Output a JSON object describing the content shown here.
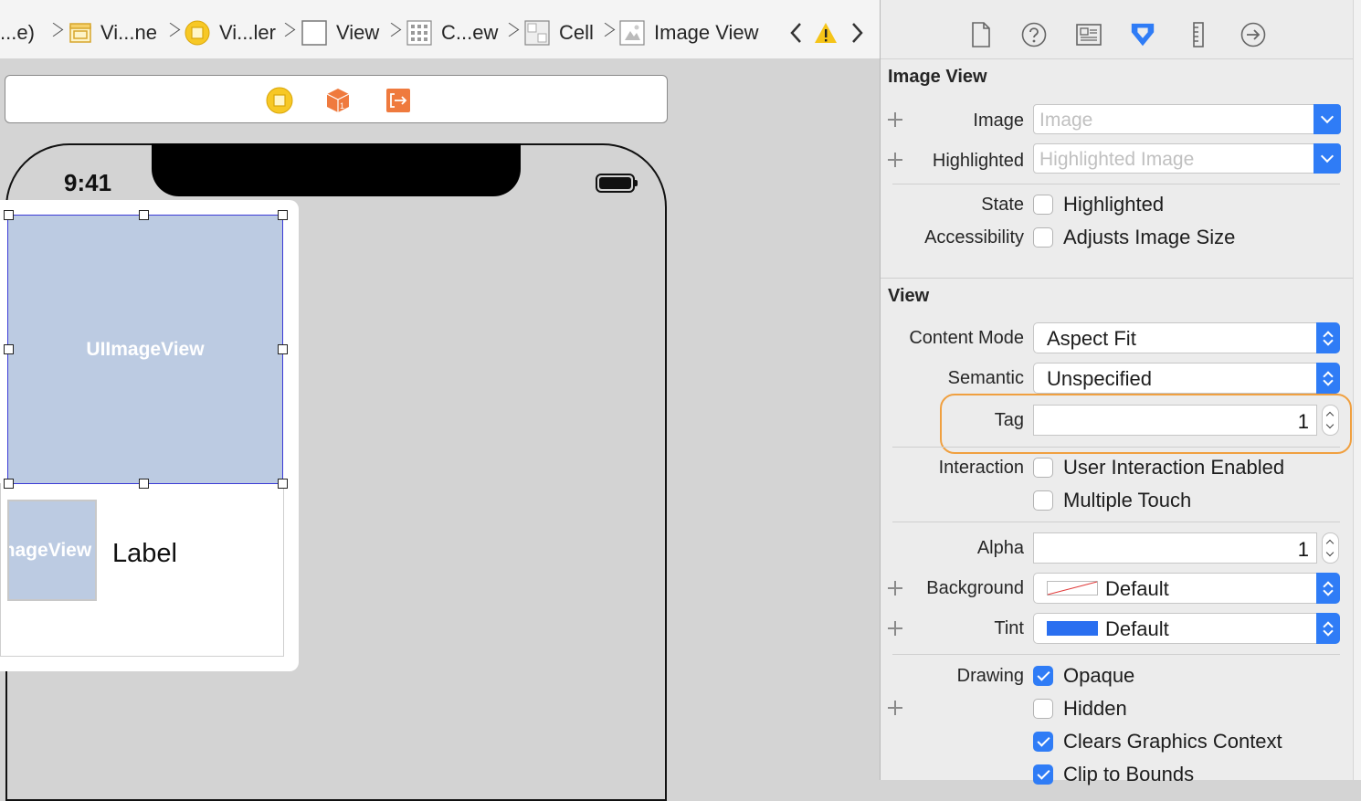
{
  "breadcrumb": {
    "items": [
      {
        "label": "...e)",
        "icon": "folder-icon"
      },
      {
        "label": "Vi...ne",
        "icon": "storyboard-scene-icon"
      },
      {
        "label": "Vi...ler",
        "icon": "view-controller-icon"
      },
      {
        "label": "View",
        "icon": "view-icon"
      },
      {
        "label": "C...ew",
        "icon": "collection-view-icon"
      },
      {
        "label": "Cell",
        "icon": "cell-icon"
      },
      {
        "label": "Image View",
        "icon": "image-view-icon"
      }
    ],
    "warning_icon": "warning-icon"
  },
  "canvas": {
    "status_time": "9:41",
    "selected_view_label": "UIImageView",
    "small_image_label": "ImageView",
    "cell_label": "Label"
  },
  "inspector": {
    "tabs": [
      "file-inspector-icon",
      "help-icon",
      "identity-icon",
      "attributes-icon",
      "size-icon",
      "connections-icon"
    ],
    "image_view": {
      "title": "Image View",
      "image_label": "Image",
      "image_placeholder": "Image",
      "highlighted_label": "Highlighted",
      "highlighted_placeholder": "Highlighted Image",
      "state_label": "State",
      "state_check": "Highlighted",
      "accessibility_label": "Accessibility",
      "accessibility_check": "Adjusts Image Size"
    },
    "view": {
      "title": "View",
      "content_mode_label": "Content Mode",
      "content_mode_value": "Aspect Fit",
      "semantic_label": "Semantic",
      "semantic_value": "Unspecified",
      "tag_label": "Tag",
      "tag_value": "1",
      "interaction_label": "Interaction",
      "user_interaction": "User Interaction Enabled",
      "multiple_touch": "Multiple Touch",
      "alpha_label": "Alpha",
      "alpha_value": "1",
      "background_label": "Background",
      "background_value": "Default",
      "tint_label": "Tint",
      "tint_value": "Default",
      "drawing_label": "Drawing",
      "opaque": "Opaque",
      "hidden": "Hidden",
      "clears_graphics": "Clears Graphics Context",
      "clip_to_bounds": "Clip to Bounds"
    },
    "colors": {
      "accent": "#2f7cf6",
      "highlight": "#f0a040",
      "tint_swatch": "#2a6ff0"
    }
  }
}
